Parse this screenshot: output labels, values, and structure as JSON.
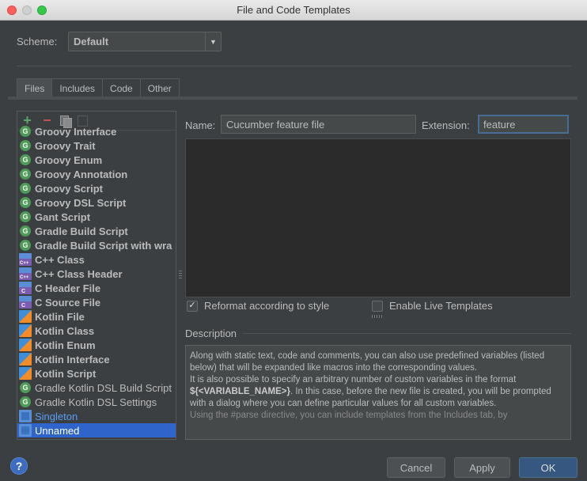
{
  "window": {
    "title": "File and Code Templates"
  },
  "scheme": {
    "label": "Scheme:",
    "value": "Default"
  },
  "tabs": [
    {
      "label": "Files",
      "active": true
    },
    {
      "label": "Includes",
      "active": false
    },
    {
      "label": "Code",
      "active": false
    },
    {
      "label": "Other",
      "active": false
    }
  ],
  "templates": [
    {
      "label": "Groovy Interface",
      "icon": "groovy-icon"
    },
    {
      "label": "Groovy Trait",
      "icon": "groovy-icon"
    },
    {
      "label": "Groovy Enum",
      "icon": "groovy-icon"
    },
    {
      "label": "Groovy Annotation",
      "icon": "groovy-icon"
    },
    {
      "label": "Groovy Script",
      "icon": "groovy-icon"
    },
    {
      "label": "Groovy DSL Script",
      "icon": "groovy-icon"
    },
    {
      "label": "Gant Script",
      "icon": "groovy-icon"
    },
    {
      "label": "Gradle Build Script",
      "icon": "groovy-icon"
    },
    {
      "label": "Gradle Build Script with wra",
      "icon": "groovy-icon"
    },
    {
      "label": "C++ Class",
      "icon": "cpp-icon"
    },
    {
      "label": "C++ Class Header",
      "icon": "cpp-icon"
    },
    {
      "label": "C Header File",
      "icon": "c-icon"
    },
    {
      "label": "C Source File",
      "icon": "c-icon"
    },
    {
      "label": "Kotlin File",
      "icon": "kotlin-icon"
    },
    {
      "label": "Kotlin Class",
      "icon": "kotlin-icon"
    },
    {
      "label": "Kotlin Enum",
      "icon": "kotlin-icon"
    },
    {
      "label": "Kotlin Interface",
      "icon": "kotlin-icon"
    },
    {
      "label": "Kotlin Script",
      "icon": "kotlin-icon"
    },
    {
      "label": "Gradle Kotlin DSL Build Script",
      "icon": "groovy-icon"
    },
    {
      "label": "Gradle Kotlin DSL Settings",
      "icon": "groovy-icon"
    },
    {
      "label": "Singleton",
      "icon": "file-icon"
    },
    {
      "label": "Unnamed",
      "icon": "file-icon"
    }
  ],
  "editor": {
    "name_label": "Name:",
    "name_value": "Cucumber feature file",
    "extension_label": "Extension:",
    "extension_value": "feature",
    "reformat_label": "Reformat according to style",
    "live_templates_label": "Enable Live Templates"
  },
  "description": {
    "title": "Description",
    "p1": "Along with static text, code and comments, you can also use predefined variables (listed below) that will be expanded like macros into the corresponding values.",
    "p2a": "It is also possible to specify an arbitrary number of custom variables in the format ",
    "p2b": "${<VARIABLE_NAME>}",
    "p2c": ". In this case, before the new file is created, you will be prompted with a dialog where you can define particular values for all custom variables.",
    "p3": "Using the #parse directive, you can include templates from the Includes tab, by"
  },
  "buttons": {
    "help": "?",
    "cancel": "Cancel",
    "apply": "Apply",
    "ok": "OK"
  },
  "colors": {
    "selection": "#2f65ca",
    "link": "#589df6",
    "background": "#3c3f41"
  }
}
